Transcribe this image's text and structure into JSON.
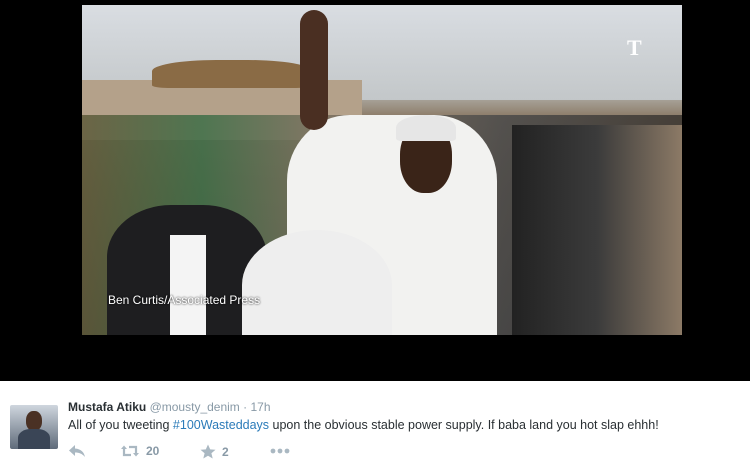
{
  "media": {
    "credit": "Ben Curtis/Associated Press",
    "logo": "T"
  },
  "tweet": {
    "name": "Mustafa Atiku",
    "handle": "@mousty_denim",
    "separator": "·",
    "time": "17h",
    "text_before": "All of you tweeting ",
    "hashtag": "#100Wasteddays",
    "text_after": " upon the obvious stable power supply. If baba land you hot slap ehhh!",
    "retweets": "20",
    "favorites": "2"
  },
  "icons": {
    "reply": "reply-icon",
    "retweet": "retweet-icon",
    "favorite": "star-icon",
    "more": "more-icon"
  },
  "colors": {
    "hashtag": "#2b7bb9",
    "muted": "#8899a6",
    "text": "#292f33"
  }
}
